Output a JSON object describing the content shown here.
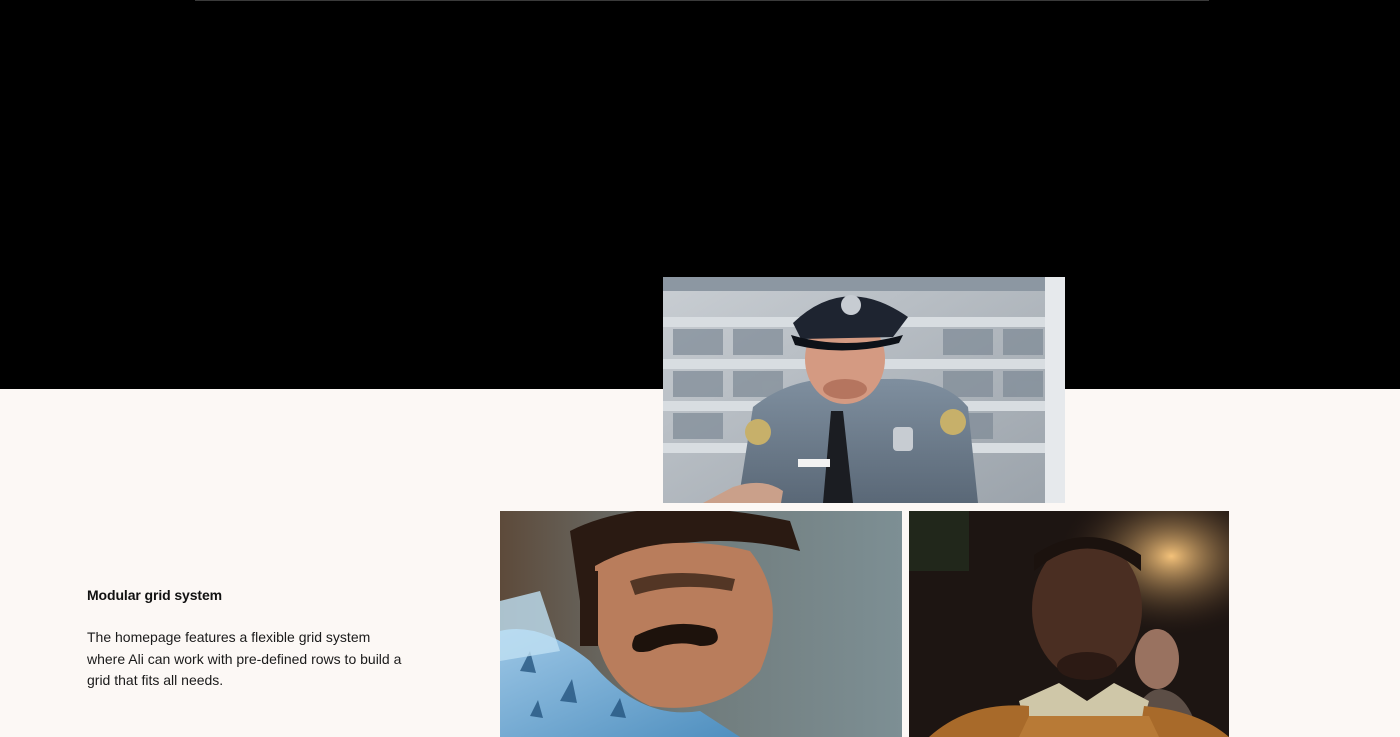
{
  "feature": {
    "title": "Modular grid system",
    "body": "The homepage features a flexible grid system where Ali can work with pre-defined rows to build a grid that fits all needs."
  },
  "colors": {
    "background": "#fcf8f5",
    "band": "#000000",
    "text": "#111111"
  }
}
